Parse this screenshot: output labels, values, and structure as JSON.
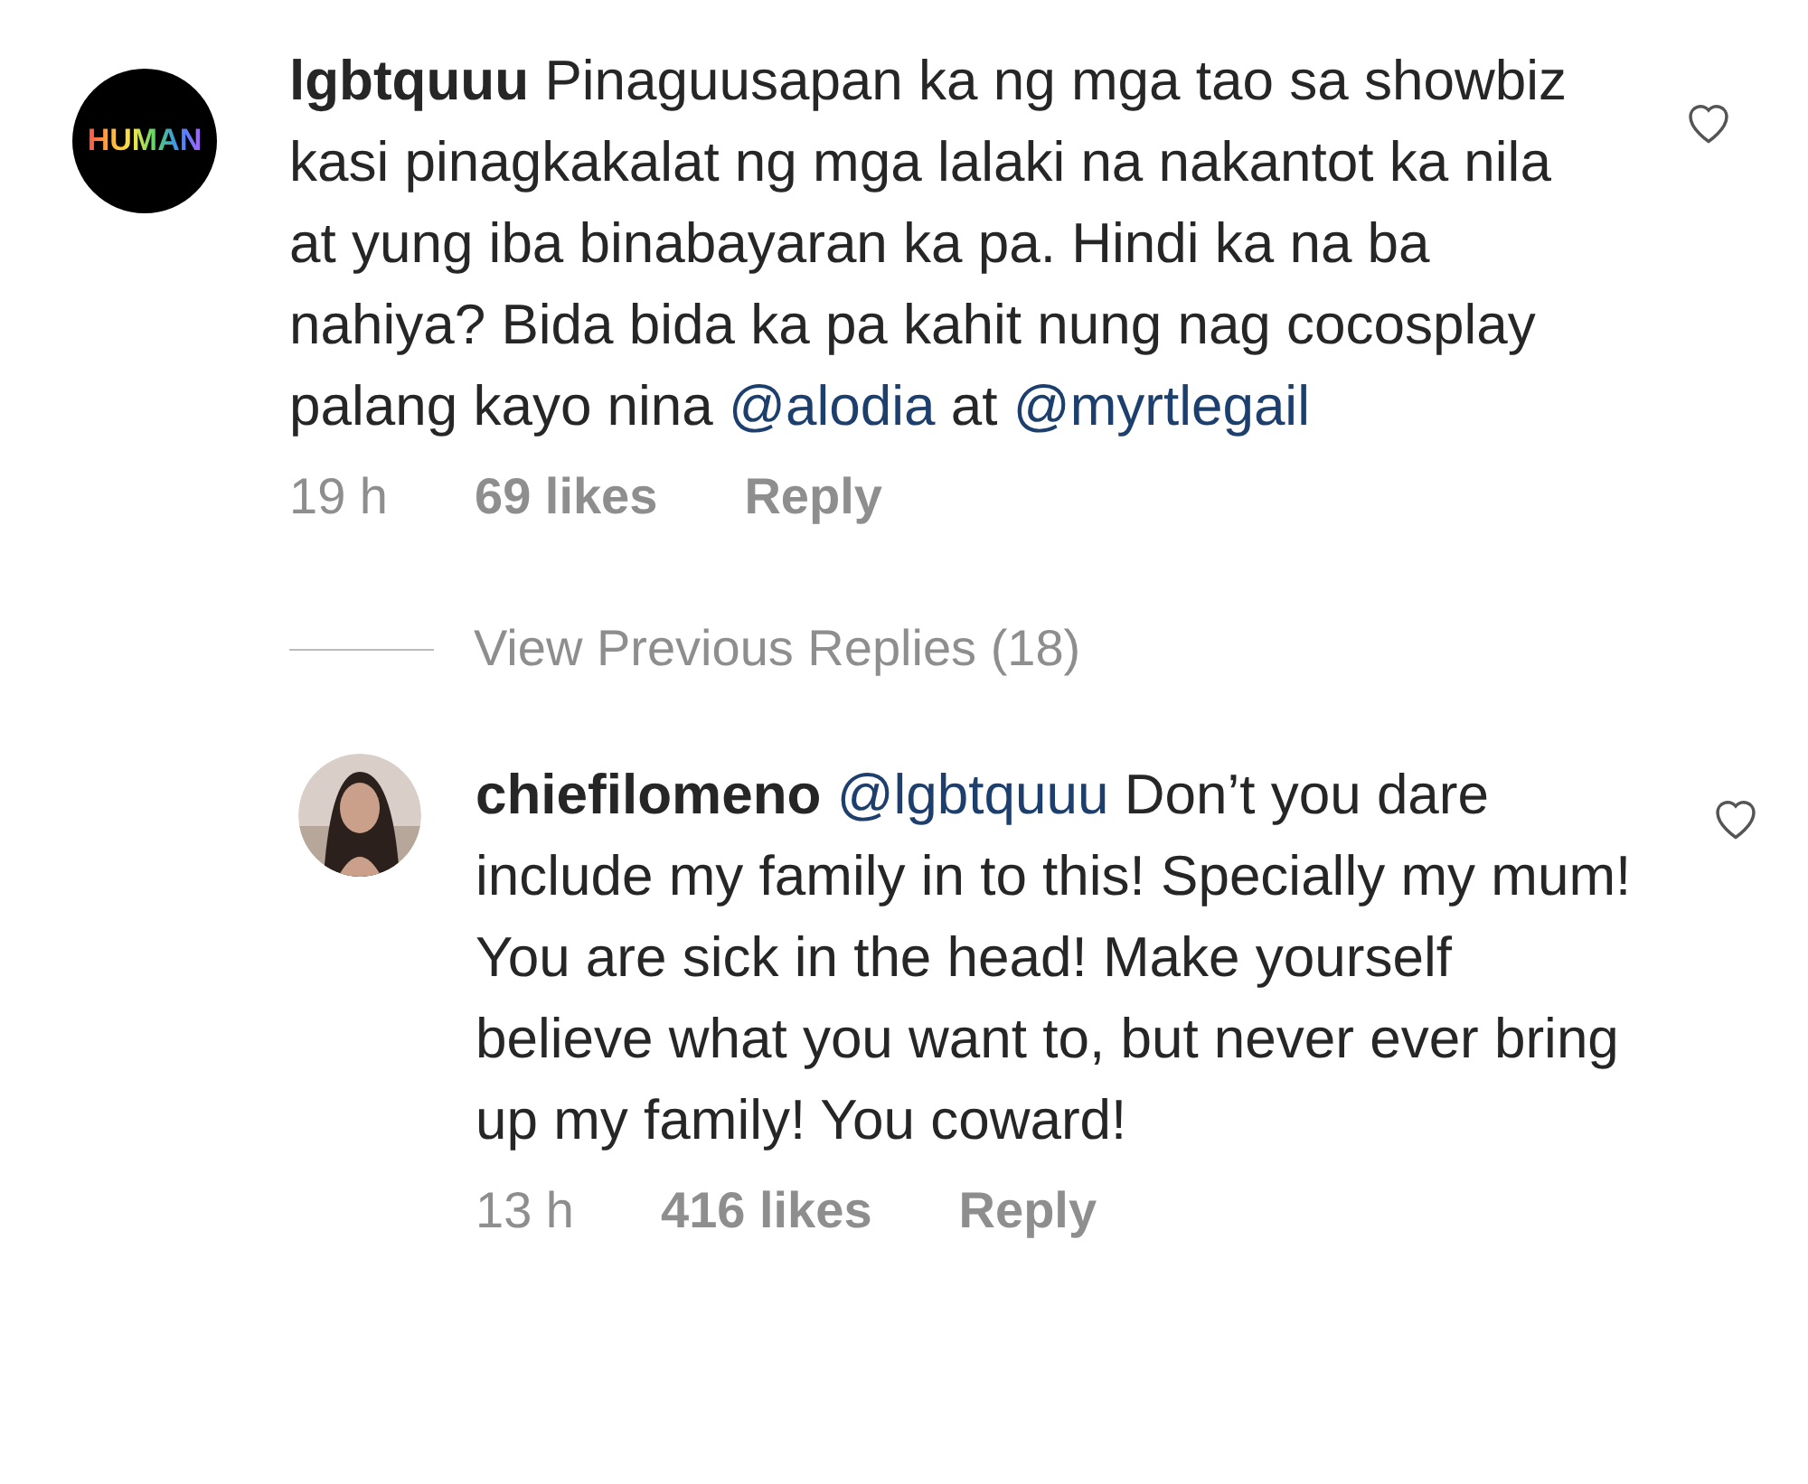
{
  "comments": [
    {
      "avatar": {
        "kind": "logo",
        "text": "HUMAN"
      },
      "username": "lgbtquuu",
      "parts": [
        {
          "kind": "text",
          "text": "Pinaguusapan ka ng mga tao sa showbiz kasi pinagkakalat ng mga lalaki na nakantot ka nila at yung iba binabayaran ka pa. Hindi ka na ba nahiya? Bida bida ka pa kahit nung nag cocosplay palang kayo nina "
        },
        {
          "kind": "mention",
          "text": "@alodia"
        },
        {
          "kind": "text",
          "text": " at "
        },
        {
          "kind": "mention",
          "text": "@myrtlegail"
        }
      ],
      "time": "19 h",
      "likes": "69 likes",
      "reply": "Reply",
      "liked": false,
      "view_replies": "View Previous Replies (18)",
      "replies": [
        {
          "username": "chiefilomeno",
          "parts": [
            {
              "kind": "mention",
              "text": "@lgbtquuu"
            },
            {
              "kind": "text",
              "text": " Don’t you dare include my family in to this! Specially my mum! You are sick in the head! Make yourself believe what you want to, but never ever bring up my family! You coward!"
            }
          ],
          "time": "13 h",
          "likes": "416 likes",
          "reply": "Reply",
          "liked": false
        }
      ]
    }
  ]
}
